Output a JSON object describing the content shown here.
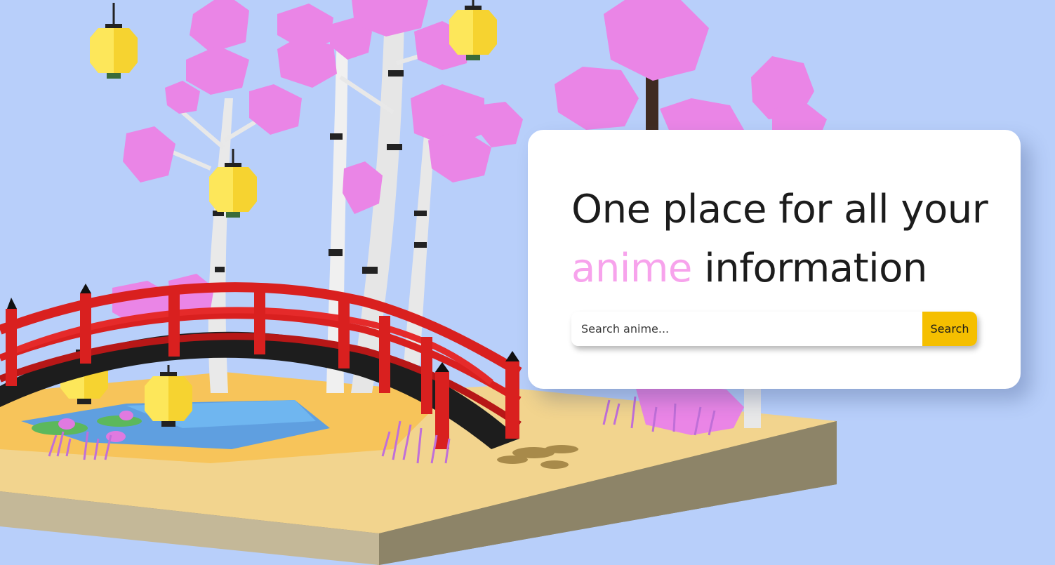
{
  "hero": {
    "headline_line1": "One place for all your",
    "headline_accent": "anime",
    "headline_line2_rest": "information"
  },
  "search": {
    "placeholder": "Search anime...",
    "value": "",
    "button_label": "Search"
  },
  "colors": {
    "background": "#b8cffa",
    "accent_pink": "#f7a3ec",
    "button_yellow": "#f5bf00",
    "bridge_red": "#dd1f1f"
  },
  "illustration": {
    "subject": "low-poly-garden-bridge-icon"
  }
}
